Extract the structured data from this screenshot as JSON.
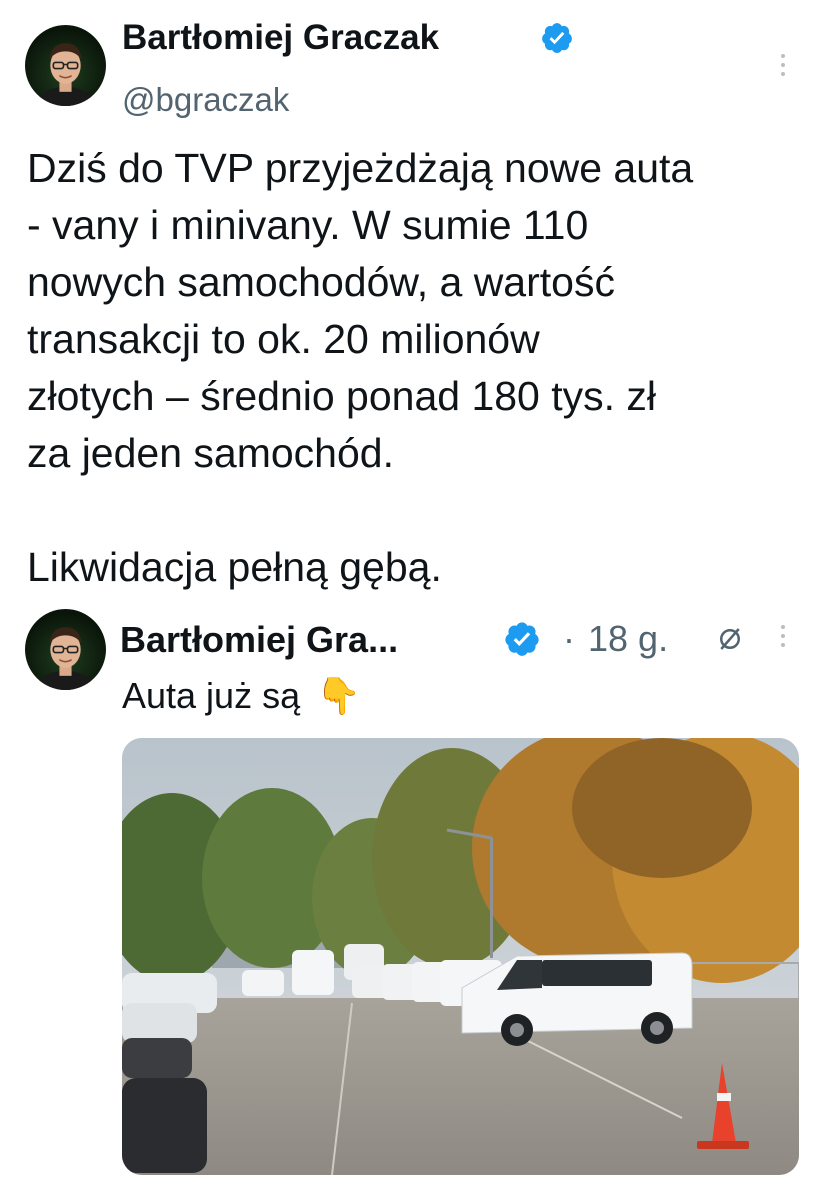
{
  "main_post": {
    "display_name": "Bartłomiej Graczak",
    "handle": "@bgraczak",
    "avatar_icon": "avatar-portrait",
    "verified_icon": "verified-badge-icon",
    "text": "Dziś do TVP przyjeżdżają nowe auta\n- vany i minivany. W sumie 110\nnowych samochodów, a wartość\ntransakcji to ok. 20 milionów\nzłotych – średnio ponad 180 tys. zł\nza jeden samochód.\n\nLikwidacja pełną gębą."
  },
  "quoted_post": {
    "display_name": "Bartłomiej Gra...",
    "dot": "·",
    "time": "18 g.",
    "icon_after_time": "null-sign-icon",
    "text": "Auta już są",
    "emoji": "👇",
    "media_description_icon": "parking-lot-photo"
  },
  "colors": {
    "verified_blue": "#1d9bf0",
    "secondary_text": "#536471",
    "primary_text": "#0f1419"
  }
}
